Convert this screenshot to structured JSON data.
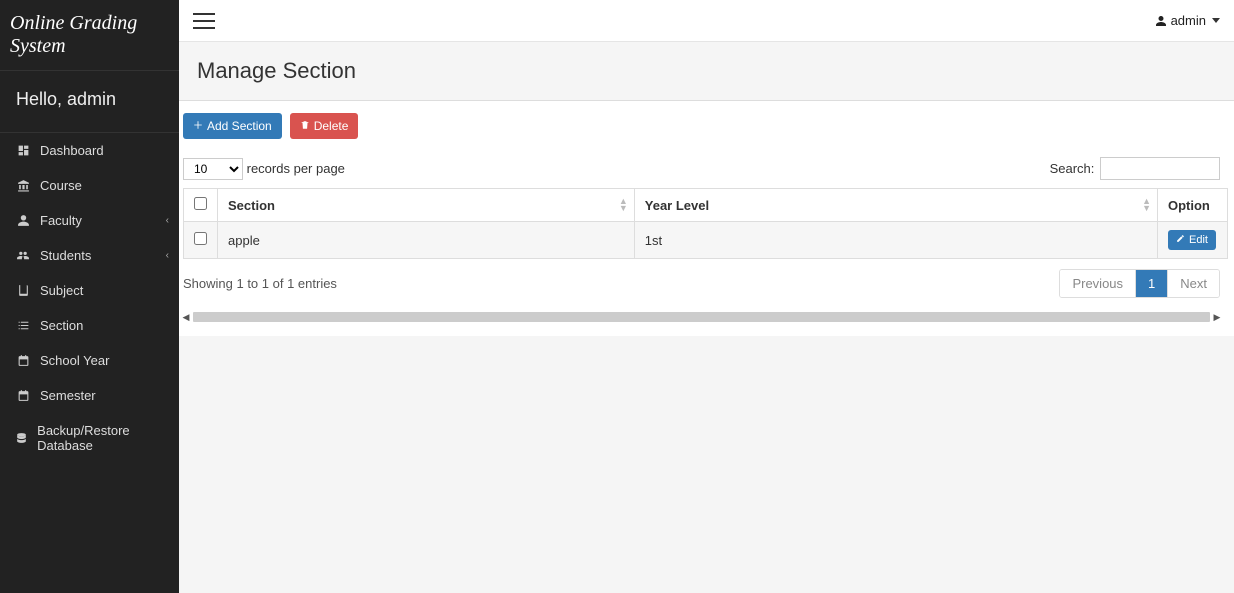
{
  "brand": "Online Grading System",
  "greeting": "Hello, admin",
  "sidebar": {
    "items": [
      {
        "label": "Dashboard",
        "icon": "dashboard"
      },
      {
        "label": "Course",
        "icon": "institution"
      },
      {
        "label": "Faculty",
        "icon": "user",
        "expandable": true
      },
      {
        "label": "Students",
        "icon": "users",
        "expandable": true
      },
      {
        "label": "Subject",
        "icon": "book"
      },
      {
        "label": "Section",
        "icon": "list"
      },
      {
        "label": "School Year",
        "icon": "calendar"
      },
      {
        "label": "Semester",
        "icon": "calendar"
      },
      {
        "label": "Backup/Restore Database",
        "icon": "database"
      }
    ]
  },
  "topbar": {
    "user_label": "admin"
  },
  "page": {
    "title": "Manage Section",
    "add_button": "Add Section",
    "delete_button": "Delete"
  },
  "table": {
    "length_value": "10",
    "length_suffix": "records per page",
    "search_label": "Search:",
    "search_value": "",
    "columns": {
      "section": "Section",
      "year_level": "Year Level",
      "option": "Option"
    },
    "rows": [
      {
        "section": "apple",
        "year_level": "1st",
        "edit_label": "Edit"
      }
    ],
    "info": "Showing 1 to 1 of 1 entries",
    "pagination": {
      "prev": "Previous",
      "page": "1",
      "next": "Next"
    }
  }
}
